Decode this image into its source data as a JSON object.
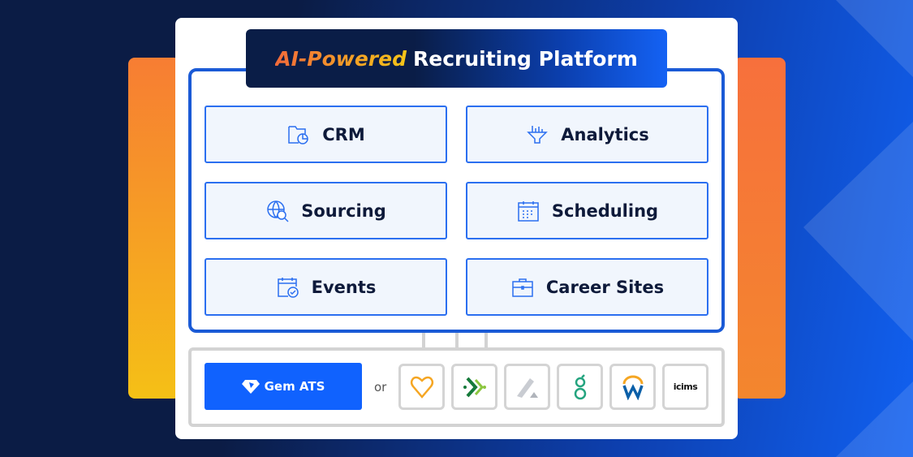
{
  "title": {
    "highlight": "AI-Powered",
    "rest": "Recruiting Platform"
  },
  "modules": [
    {
      "label": "CRM",
      "icon": "folder-pie-chart-icon"
    },
    {
      "label": "Analytics",
      "icon": "funnel-bar-chart-icon"
    },
    {
      "label": "Sourcing",
      "icon": "globe-person-search-icon"
    },
    {
      "label": "Scheduling",
      "icon": "calendar-icon"
    },
    {
      "label": "Events",
      "icon": "calendar-check-icon"
    },
    {
      "label": "Career Sites",
      "icon": "briefcase-icon"
    }
  ],
  "ats": {
    "gem_label": "Gem ATS",
    "or_label": "or",
    "partner_logos": [
      "heart-logo",
      "cross-arrows-logo",
      "triangle-logo",
      "greenhouse-g-logo",
      "workday-logo",
      "icims-logo"
    ],
    "icims_text": "icims"
  },
  "colors": {
    "accent": "#1062fe",
    "frame": "#1a5ad6",
    "orange": "#f77d33",
    "navy": "#0b1c45"
  }
}
